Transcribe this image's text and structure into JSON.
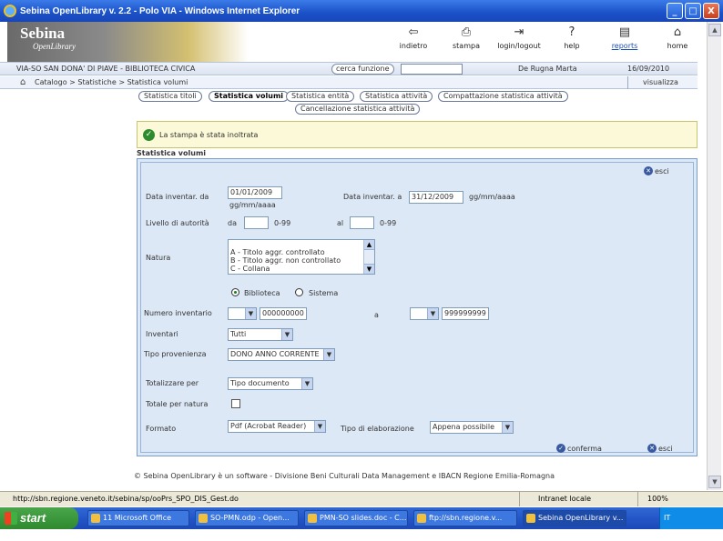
{
  "window": {
    "title": "Sebina OpenLibrary v. 2.2 - Polo VIA - Windows Internet Explorer",
    "minimize": "_",
    "maximize": "□",
    "close": "X"
  },
  "logo": {
    "line1": "Sebina",
    "line2": "OpenLibrary"
  },
  "toolbar": [
    {
      "label": "indietro",
      "icon": "back-icon"
    },
    {
      "label": "stampa",
      "icon": "print-icon"
    },
    {
      "label": "login/logout",
      "icon": "login-icon"
    },
    {
      "label": "help",
      "icon": "help-icon"
    },
    {
      "label": "reports",
      "icon": "reports-icon"
    },
    {
      "label": "home",
      "icon": "home-icon"
    }
  ],
  "infobar": {
    "library": "VIA-SO SAN DONA' DI PIAVE - BIBLIOTECA CIVICA",
    "search_button": "cerca funzione",
    "search_value": "",
    "user": "De Rugna Marta",
    "date": "16/09/2010"
  },
  "breadcrumb": {
    "text": "Catalogo > Statistiche > Statistica volumi",
    "visualize": "visualizza"
  },
  "tabs": [
    "Statistica titoli",
    "Statistica volumi",
    "Statistica entità",
    "Statistica attività",
    "Compattazione statistica attività",
    "Cancellazione statistica attività"
  ],
  "message": "La stampa è stata inoltrata",
  "section_title": "Statistica volumi",
  "form": {
    "esci": "esci",
    "conferma": "conferma",
    "date_from_label": "Data inventar. da",
    "date_from_value": "01/01/2009",
    "date_format_1": "gg/mm/aaaa",
    "date_to_label": "Data inventar. a",
    "date_to_value": "31/12/2009",
    "date_format_2": "gg/mm/aaaa",
    "authority_label": "Livello di autorità",
    "authority_da": "da",
    "authority_range1": "0-99",
    "authority_a": "al",
    "authority_range2": "0-99",
    "natura_label": "Natura",
    "natura_options": [
      "A - Titolo aggr. controllato",
      "B - Titolo aggr. non controllato",
      "C - Collana"
    ],
    "radio_biblioteca": "Biblioteca",
    "radio_sistema": "Sistema",
    "inventory_label": "Numero inventario",
    "inventory_from": "000000000",
    "inventory_a": "a",
    "inventory_to": "999999999",
    "inventari_label": "Inventari",
    "inventari_value": "Tutti",
    "provenienza_label": "Tipo provenienza",
    "provenienza_value": "DONO ANNO CORRENTE",
    "aggregate_label": "Totalizzare per",
    "aggregate_value": "Tipo documento",
    "total_natura_label": "Totale per natura",
    "format_label": "Formato",
    "format_value": "Pdf (Acrobat Reader)",
    "elaboration_label": "Tipo di elaborazione",
    "elaboration_value": "Appena possibile"
  },
  "footer": "© Sebina OpenLibrary è un software - Divisione Beni Culturali Data Management e IBACN Regione Emilia-Romagna",
  "statusbar": {
    "url": "http://sbn.regione.veneto.it/sebina/sp/ooPrs_SPO_DIS_Gest.do",
    "zone": "Intranet locale",
    "zoom": "100%"
  },
  "taskbar": {
    "start": "start",
    "tasks": [
      "11 Microsoft Office",
      "SO-PMN.odp - Open...",
      "PMN-SO slides.doc - C...",
      "ftp://sbn.regione.v...",
      "Sebina OpenLibrary v..."
    ],
    "tray": "IT"
  }
}
